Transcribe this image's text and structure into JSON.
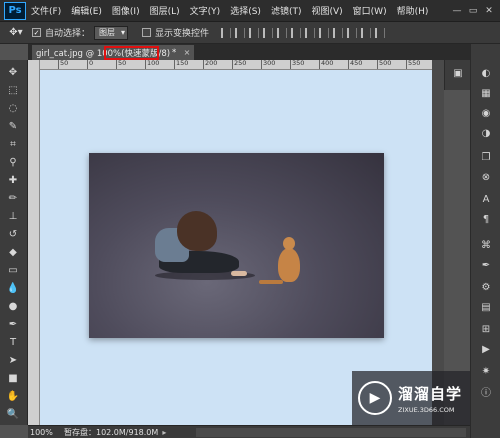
{
  "app": {
    "logo": "Ps"
  },
  "menu": [
    "文件(F)",
    "编辑(E)",
    "图像(I)",
    "图层(L)",
    "文字(Y)",
    "选择(S)",
    "滤镜(T)",
    "视图(V)",
    "窗口(W)",
    "帮助(H)"
  ],
  "window_controls": {
    "minimize": "—",
    "restore": "▭",
    "close": "✕"
  },
  "options": {
    "tool_icon": "move-tool",
    "auto_select_label": "自动选择：",
    "auto_select_checked": true,
    "auto_select_value": "图层",
    "show_transform_label": "显示变换控件",
    "show_transform_checked": false
  },
  "document": {
    "tab_label": "girl_cat.jpg @ 100%(快速蒙版/8)",
    "tab_modified": "*",
    "close": "×"
  },
  "ruler": {
    "ticks": [
      "50",
      "0",
      "50",
      "100",
      "150",
      "200",
      "250",
      "300",
      "350",
      "400",
      "450",
      "500",
      "550"
    ]
  },
  "status": {
    "zoom": "100%",
    "info": "暂存盘：102.0M/918.0M",
    "arrow": "▸"
  },
  "watermark": {
    "title": "溜溜自学",
    "url": "ZIXUE.3D66.COM"
  },
  "colors": {
    "canvas_bg": "#cde2f5",
    "highlight": "#e01010",
    "chrome_dark": "#2d2d2d",
    "ps_blue": "#31a8ff"
  }
}
